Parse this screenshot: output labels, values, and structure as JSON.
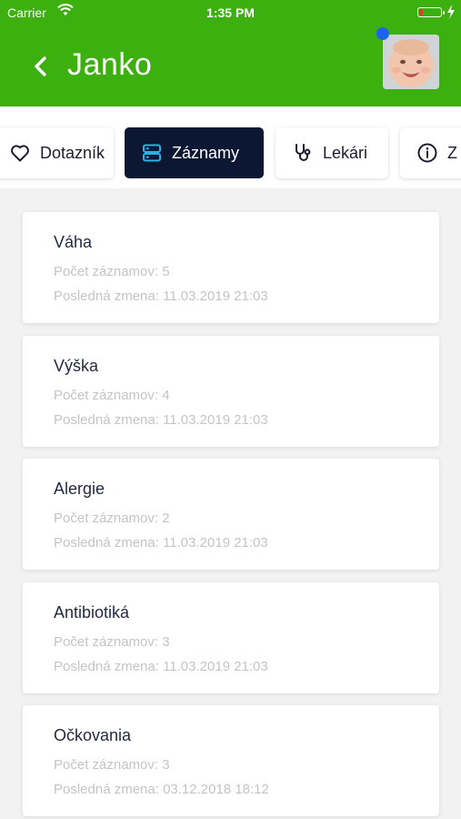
{
  "status_bar": {
    "carrier": "Carrier",
    "time": "1:35 PM"
  },
  "header": {
    "title": "Janko",
    "back_icon": "chevron-left-icon",
    "accent_color": "#3cb00f"
  },
  "tabs": [
    {
      "label": "Dotazník",
      "icon": "heart-icon",
      "active": false
    },
    {
      "label": "Záznamy",
      "icon": "server-icon",
      "active": true
    },
    {
      "label": "Lekári",
      "icon": "stethoscope-icon",
      "active": false
    },
    {
      "label": "Z",
      "icon": "info-icon",
      "active": false
    }
  ],
  "records": [
    {
      "title": "Váha",
      "count": "Počet záznamov: 5",
      "last_change": "Posledná zmena: 11.03.2019 21:03"
    },
    {
      "title": "Výška",
      "count": "Počet záznamov: 4",
      "last_change": "Posledná zmena: 11.03.2019 21:03"
    },
    {
      "title": "Alergie",
      "count": "Počet záznamov: 2",
      "last_change": "Posledná zmena: 11.03.2019 21:03"
    },
    {
      "title": "Antibiotiká",
      "count": "Počet záznamov: 3",
      "last_change": "Posledná zmena: 11.03.2019 21:03"
    },
    {
      "title": "Očkovania",
      "count": "Počet záznamov: 3",
      "last_change": "Posledná zmena: 03.12.2018 18:12"
    }
  ]
}
